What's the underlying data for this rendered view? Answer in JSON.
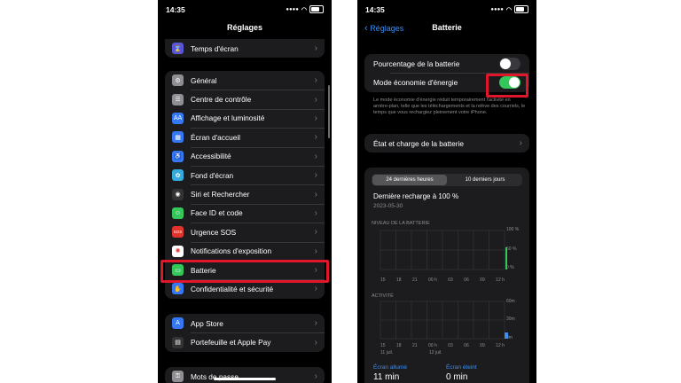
{
  "status": {
    "time": "14:35",
    "left_time": "14:35",
    "right_time": "14:35"
  },
  "left": {
    "title": "Réglages",
    "top_item": {
      "label": "Temps d'écran",
      "icon": "hourglass-icon",
      "color": "#5856d6"
    },
    "items": [
      {
        "label": "Général",
        "icon": "gear-icon",
        "color": "#8e8e93"
      },
      {
        "label": "Centre de contrôle",
        "icon": "sliders-icon",
        "color": "#8e8e93"
      },
      {
        "label": "Affichage et luminosité",
        "icon": "aa-icon",
        "color": "#3478f6"
      },
      {
        "label": "Écran d'accueil",
        "icon": "grid-icon",
        "color": "#3478f6"
      },
      {
        "label": "Accessibilité",
        "icon": "accessibility-icon",
        "color": "#3478f6"
      },
      {
        "label": "Fond d'écran",
        "icon": "flower-icon",
        "color": "#35aadc"
      },
      {
        "label": "Siri et Rechercher",
        "icon": "siri-icon",
        "color": "#333333"
      },
      {
        "label": "Face ID et code",
        "icon": "face-id-icon",
        "color": "#34c759"
      },
      {
        "label": "Urgence SOS",
        "icon": "sos-icon",
        "color": "#e0332b"
      },
      {
        "label": "Notifications d'exposition",
        "icon": "exposure-icon",
        "color": "#ffffff"
      },
      {
        "label": "Batterie",
        "icon": "battery-icon",
        "color": "#34c759"
      },
      {
        "label": "Confidentialité et sécurité",
        "icon": "hand-icon",
        "color": "#3478f6"
      }
    ],
    "store_items": [
      {
        "label": "App Store",
        "icon": "app-store-icon",
        "color": "#3478f6"
      },
      {
        "label": "Portefeuille et Apple Pay",
        "icon": "wallet-icon",
        "color": "#333333"
      }
    ],
    "bottom_item": {
      "label": "Mots de passe",
      "icon": "key-icon",
      "color": "#8e8e93"
    }
  },
  "right": {
    "back_label": "Réglages",
    "title": "Batterie",
    "toggles": [
      {
        "label": "Pourcentage de la batterie",
        "on": false
      },
      {
        "label": "Mode économie d'énergie",
        "on": true
      }
    ],
    "description": "Le mode économie d'énergie réduit temporairement l'activité en arrière-plan, telle que les téléchargements et la relève des courriels, le temps que vous rechargiez pleinement votre iPhone.",
    "state_row": "État et charge de la batterie",
    "segments": [
      "24 dernières heures",
      "10 derniers jours"
    ],
    "last_charge": "Dernière recharge à 100 %",
    "last_charge_date": "2023-05-30",
    "battery_title": "NIVEAU DE LA BATTERIE",
    "battery_ylabels": [
      "100 %",
      "50 %",
      "0 %"
    ],
    "activity_title": "ACTIVITÉ",
    "activity_ylabels": [
      "60m",
      "30m",
      "0m"
    ],
    "x_ticks": [
      "15",
      "18",
      "21",
      "00 h",
      "03",
      "06",
      "09",
      "12 h"
    ],
    "x_dates": [
      "11 juil.",
      "12 juil."
    ],
    "screen_on_label": "Écran allumé",
    "screen_on_value": "11 min",
    "screen_off_label": "Écran éteint",
    "screen_off_value": "0 min",
    "accent": "#3a8ff5",
    "toggle_on_color": "#34c759",
    "highlight_color": "#e0162b"
  }
}
